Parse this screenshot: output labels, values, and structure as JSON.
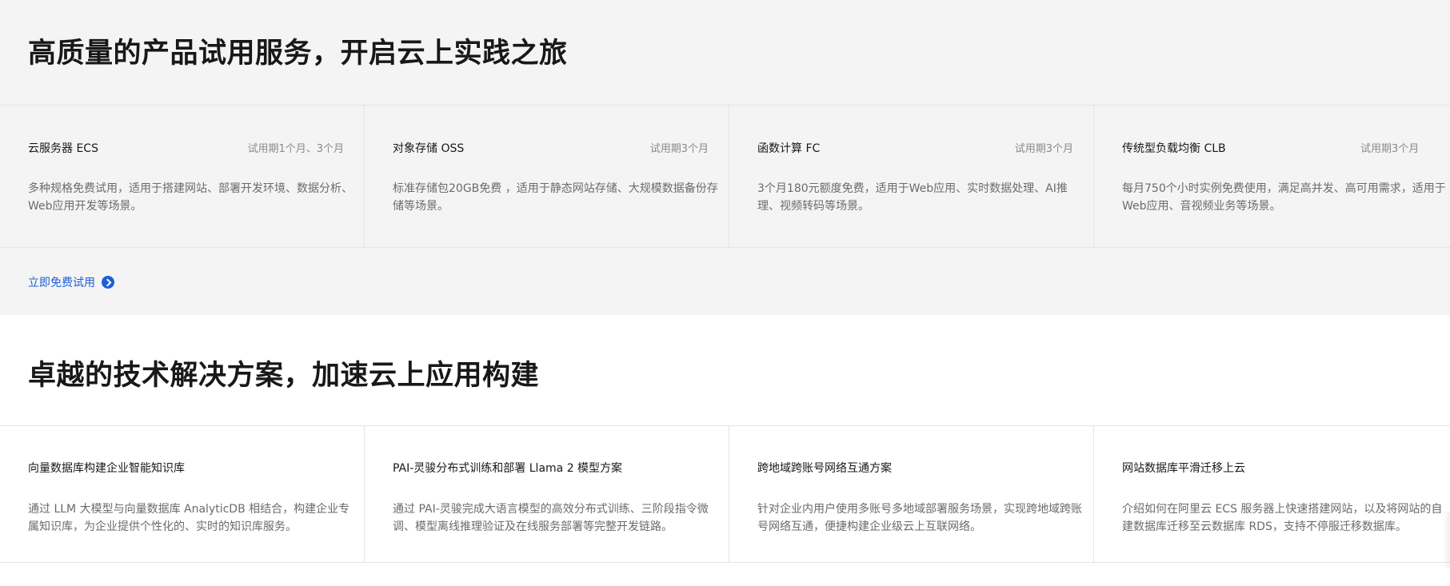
{
  "trial": {
    "title": "高质量的产品试用服务，开启云上实践之旅",
    "cards": [
      {
        "name": "云服务器 ECS",
        "period": "试用期1个月、3个月",
        "desc": "多种规格免费试用，适用于搭建网站、部署开发环境、数据分析、Web应用开发等场景。"
      },
      {
        "name": "对象存储 OSS",
        "period": "试用期3个月",
        "desc": "标准存储包20GB免费 ，适用于静态网站存储、大规模数据备份存储等场景。"
      },
      {
        "name": "函数计算 FC",
        "period": "试用期3个月",
        "desc": "3个月180元额度免费，适用于Web应用、实时数据处理、AI推理、视频转码等场景。"
      },
      {
        "name": "传统型负载均衡 CLB",
        "period": "试用期3个月",
        "desc": "每月750个小时实例免费使用，满足高并发、高可用需求，适用于Web应用、音视频业务等场景。"
      }
    ],
    "cta_label": "立即免费试用",
    "cta_icon": "chevron-right-circle-icon",
    "accent_color": "#1e5fd6"
  },
  "solutions": {
    "title": "卓越的技术解决方案，加速云上应用构建",
    "cards": [
      {
        "name": "向量数据库构建企业智能知识库",
        "desc": "通过 LLM 大模型与向量数据库 AnalyticDB 相结合，构建企业专属知识库，为企业提供个性化的、实时的知识库服务。"
      },
      {
        "name": "PAI-灵骏分布式训练和部署 Llama 2 模型方案",
        "desc": "通过 PAI-灵骏完成大语言模型的高效分布式训练、三阶段指令微调、模型离线推理验证及在线服务部署等完整开发链路。"
      },
      {
        "name": "跨地域跨账号网络互通方案",
        "desc": "针对企业内用户使用多账号多地域部署服务场景，实现跨地域跨账号网络互通，便捷构建企业级云上互联网络。"
      },
      {
        "name": "网站数据库平滑迁移上云",
        "desc": "介绍如何在阿里云 ECS 服务器上快速搭建网站，以及将网站的自建数据库迁移至云数据库 RDS，支持不停服迁移数据库。"
      }
    ]
  }
}
